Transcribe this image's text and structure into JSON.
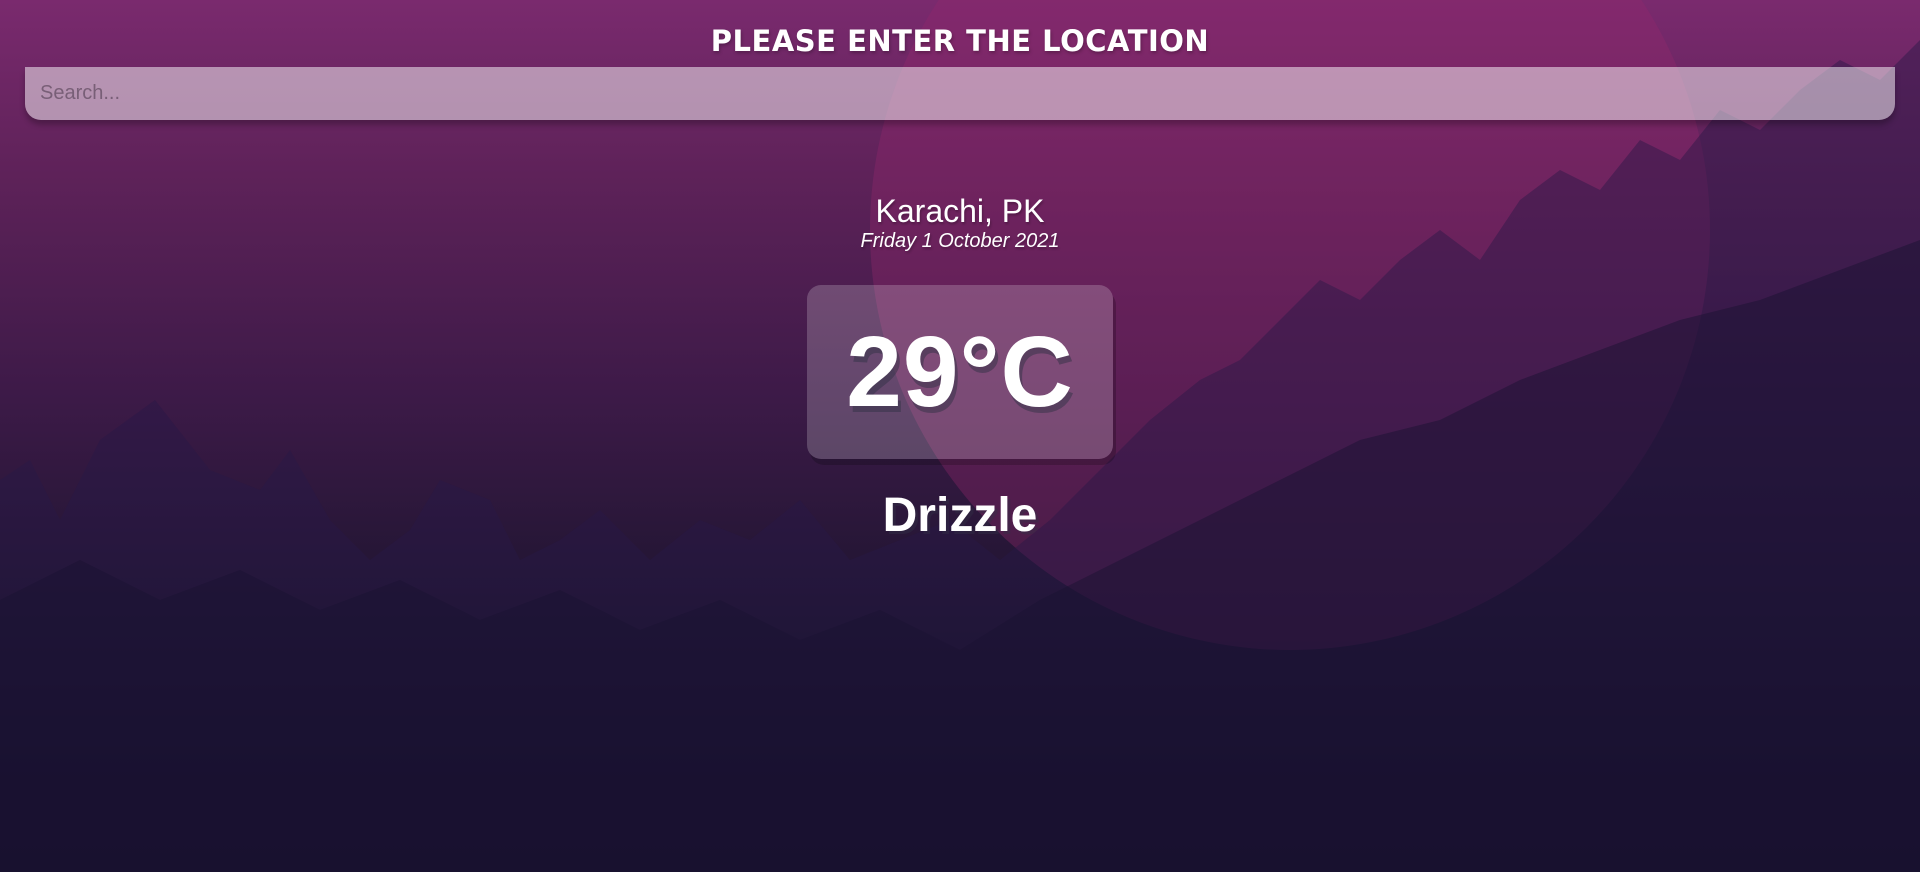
{
  "header": {
    "title": "PLEASE ENTER THE LOCATION"
  },
  "search": {
    "placeholder": "Search...",
    "value": ""
  },
  "weather": {
    "location": "Karachi, PK",
    "date": "Friday 1 October 2021",
    "temperature": "29°C",
    "condition": "Drizzle"
  },
  "colors": {
    "background_top": "#7a2a6e",
    "background_bottom": "#0a0a18",
    "text": "#ffffff"
  }
}
